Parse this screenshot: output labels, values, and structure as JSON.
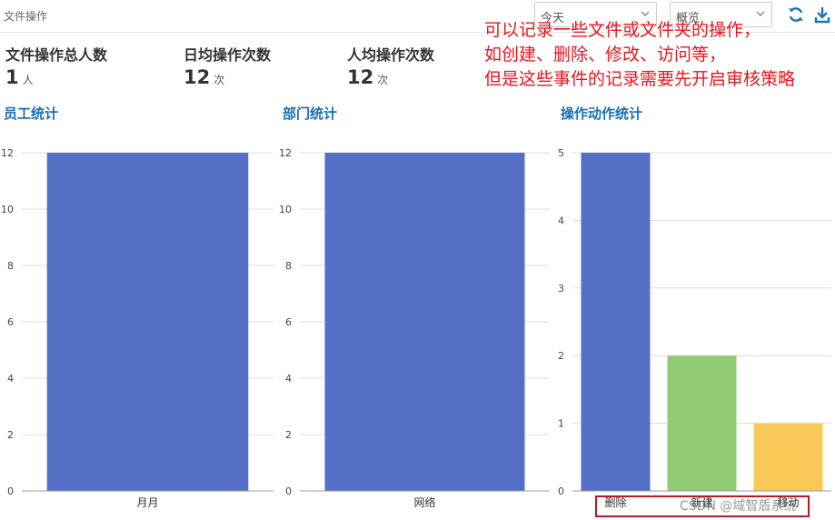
{
  "page": {
    "title": "文件操作"
  },
  "filters": {
    "date_range": "今天",
    "view": "概览"
  },
  "toolbar": {
    "refresh_icon": "refresh-icon",
    "download_icon": "download-icon",
    "accent": "#1e73be"
  },
  "stats": [
    {
      "label": "文件操作总人数",
      "value": "1",
      "unit": "人"
    },
    {
      "label": "日均操作次数",
      "value": "12",
      "unit": "次"
    },
    {
      "label": "人均操作次数",
      "value": "12",
      "unit": "次"
    }
  ],
  "annotation": {
    "lines": [
      "可以记录一些文件或文件夹的操作，",
      "如创建、删除、修改、访问等，",
      "但是这些事件的记录需要先开启审核策略"
    ],
    "color": "#e8141c"
  },
  "watermark": "CSDN @域智盾系统",
  "chart_data": [
    {
      "type": "bar",
      "title": "员工统计",
      "categories": [
        "月月"
      ],
      "values": [
        12
      ],
      "ylim": [
        0,
        12
      ],
      "yticks": [
        0,
        2,
        4,
        6,
        8,
        10,
        12
      ],
      "colors": [
        "#5470c6"
      ],
      "grid": true
    },
    {
      "type": "bar",
      "title": "部门统计",
      "categories": [
        "网络"
      ],
      "values": [
        12
      ],
      "ylim": [
        0,
        12
      ],
      "yticks": [
        0,
        2,
        4,
        6,
        8,
        10,
        12
      ],
      "colors": [
        "#5470c6"
      ],
      "grid": true
    },
    {
      "type": "bar",
      "title": "操作动作统计",
      "categories": [
        "删除",
        "新建",
        "移动"
      ],
      "values": [
        5,
        2,
        1
      ],
      "ylim": [
        0,
        5
      ],
      "yticks": [
        0,
        1,
        2,
        3,
        4,
        5
      ],
      "colors": [
        "#5470c6",
        "#91cc75",
        "#fac858"
      ],
      "grid": true
    }
  ]
}
